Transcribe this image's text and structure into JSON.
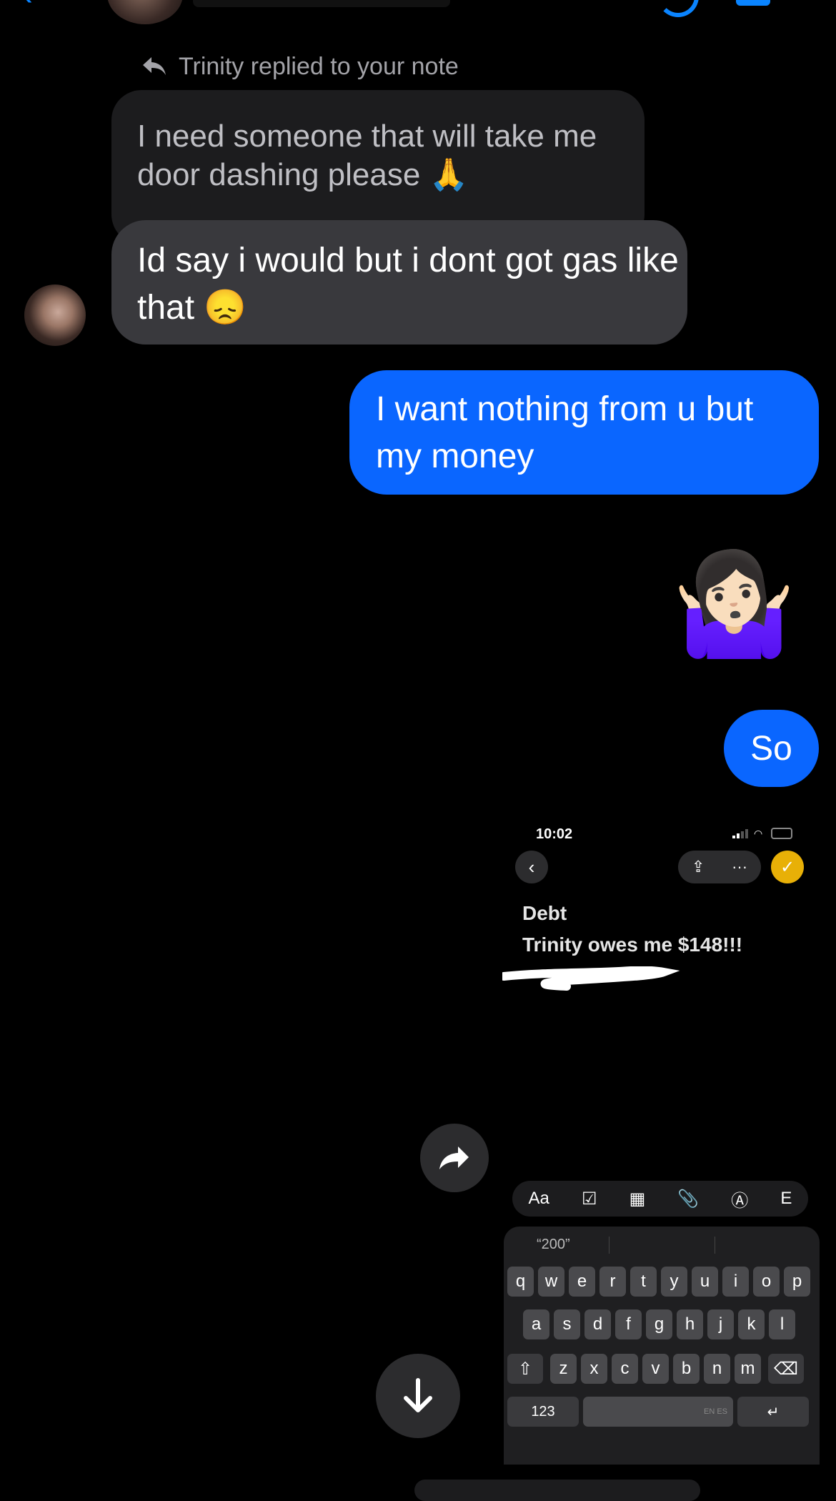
{
  "reply_header": {
    "text": "Trinity replied to your note"
  },
  "note": {
    "text": "I need someone that will take me door dashing please 🙏"
  },
  "messages": [
    {
      "from": "them",
      "text": "Id say i would but i dont got gas like that 😞"
    },
    {
      "from": "me",
      "text": "I want nothing from u but my money"
    },
    {
      "from": "me",
      "emoji": "🤷🏻‍♀️"
    },
    {
      "from": "me",
      "text": "So"
    }
  ],
  "screenshot": {
    "time": "10:02",
    "note_title": "Debt",
    "note_body": "Trinity owes me $148!!!",
    "toolbar": [
      "Aa",
      "☑",
      "▦",
      "📎",
      "Ⓐ",
      "E"
    ],
    "keyboard": {
      "prediction": "“200”",
      "row1": [
        "q",
        "w",
        "e",
        "r",
        "t",
        "y",
        "u",
        "i",
        "o",
        "p"
      ],
      "row2": [
        "a",
        "s",
        "d",
        "f",
        "g",
        "h",
        "j",
        "k",
        "l"
      ],
      "row3": [
        "z",
        "x",
        "c",
        "v",
        "b",
        "n",
        "m"
      ],
      "numbers_key": "123",
      "space_hint": "EN ES"
    }
  },
  "colors": {
    "sent_bubble": "#0a66ff",
    "received_bubble": "#39393d",
    "note_bubble": "#1c1c1e",
    "accent": "#0a84ff"
  }
}
